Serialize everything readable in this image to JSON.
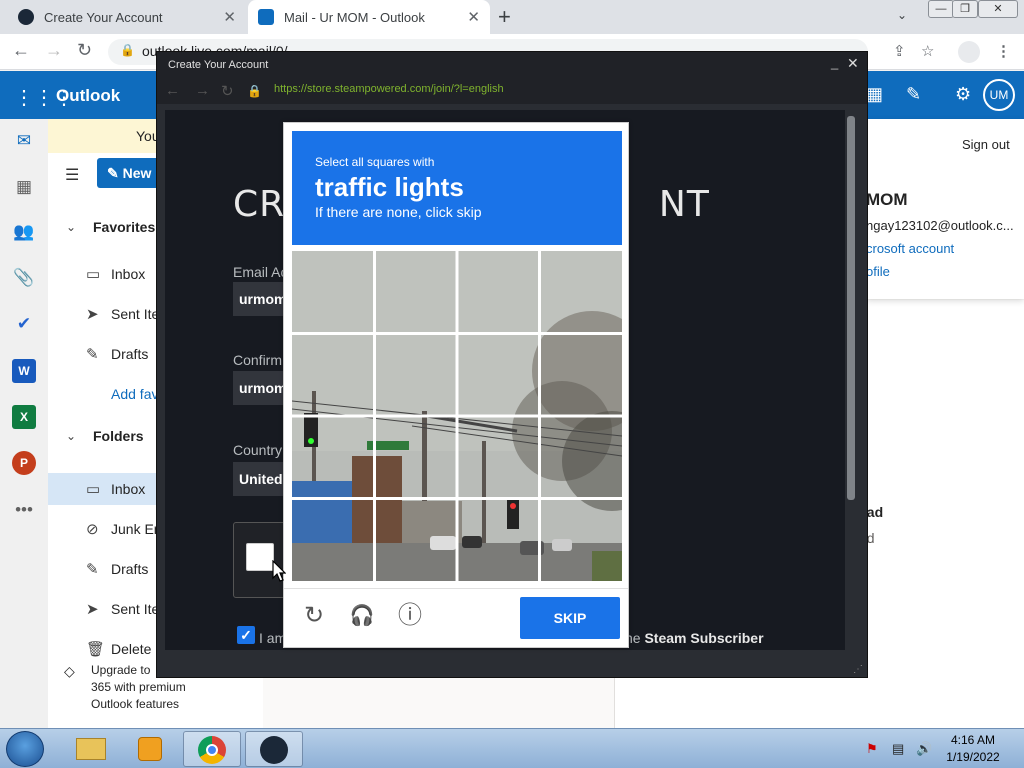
{
  "browser": {
    "tabs": [
      {
        "title": "Create Your Account",
        "icon": "steam-icon",
        "active": false
      },
      {
        "title": "Mail - Ur MOM - Outlook",
        "icon": "outlook-icon",
        "active": true
      }
    ],
    "new_tab_glyph": "+",
    "address": "outlook.live.com/mail/0/",
    "back_glyph": "←",
    "forward_glyph": "→",
    "reload_glyph": "↻",
    "window_controls": {
      "minimize": "—",
      "maximize": "❐",
      "close": "✕"
    }
  },
  "outlook": {
    "brand": "Outlook",
    "avatar_initials": "UM",
    "banner_text": "You",
    "new_button_label": "New",
    "nav": [
      {
        "label": "Favorites",
        "icon": "chevron-down-icon",
        "type": "section"
      },
      {
        "label": "Inbox",
        "icon": "inbox-icon",
        "type": "item"
      },
      {
        "label": "Sent Ite",
        "icon": "send-icon",
        "type": "item"
      },
      {
        "label": "Drafts",
        "icon": "pencil-icon",
        "type": "item"
      },
      {
        "label": "Add fav",
        "icon": "",
        "type": "add"
      },
      {
        "label": "Folders",
        "icon": "chevron-down-icon",
        "type": "section"
      },
      {
        "label": "Inbox",
        "icon": "inbox-icon",
        "type": "selected"
      },
      {
        "label": "Junk Em",
        "icon": "block-icon",
        "type": "item"
      },
      {
        "label": "Drafts",
        "icon": "pencil-icon",
        "type": "item"
      },
      {
        "label": "Sent Ite",
        "icon": "send-icon",
        "type": "item"
      },
      {
        "label": "Delete",
        "icon": "trash-icon",
        "type": "item"
      }
    ],
    "upgrade_text": "Upgrade to Microsoft 365 with premium Outlook features",
    "upgrade_lines": [
      "Upgrade to",
      "365 with premium",
      "Outlook features"
    ],
    "account_card": {
      "sign_out": "Sign out",
      "name": "MOM",
      "email": "ngay123102@outlook.c...",
      "account_link": "crosoft account",
      "profile_link": "ofile"
    },
    "reading_pane": {
      "line1": "ead",
      "line2": "ed"
    }
  },
  "steam": {
    "window_title": "Create Your Account",
    "url": "https://store.steampowered.com/join/?l=english",
    "heading_left": "CRE",
    "heading_right": "NT",
    "email_label": "Email Ac",
    "email_value": "urmom",
    "confirm_label": "Confirm",
    "confirm_value": "urmom",
    "country_label": "Country",
    "country_value": "United",
    "agree_text": "I am",
    "subscriber_prefix": "he",
    "subscriber_text": "Steam Subscriber"
  },
  "captcha": {
    "instruction_top": "Select all squares with",
    "target": "traffic lights",
    "instruction_bottom": "If there are none, click skip",
    "skip_label": "SKIP",
    "reload_icon": "↻",
    "audio_icon": "🎧",
    "info_icon": "ⓘ"
  },
  "taskbar": {
    "time": "4:16 AM",
    "date": "1/19/2022"
  }
}
